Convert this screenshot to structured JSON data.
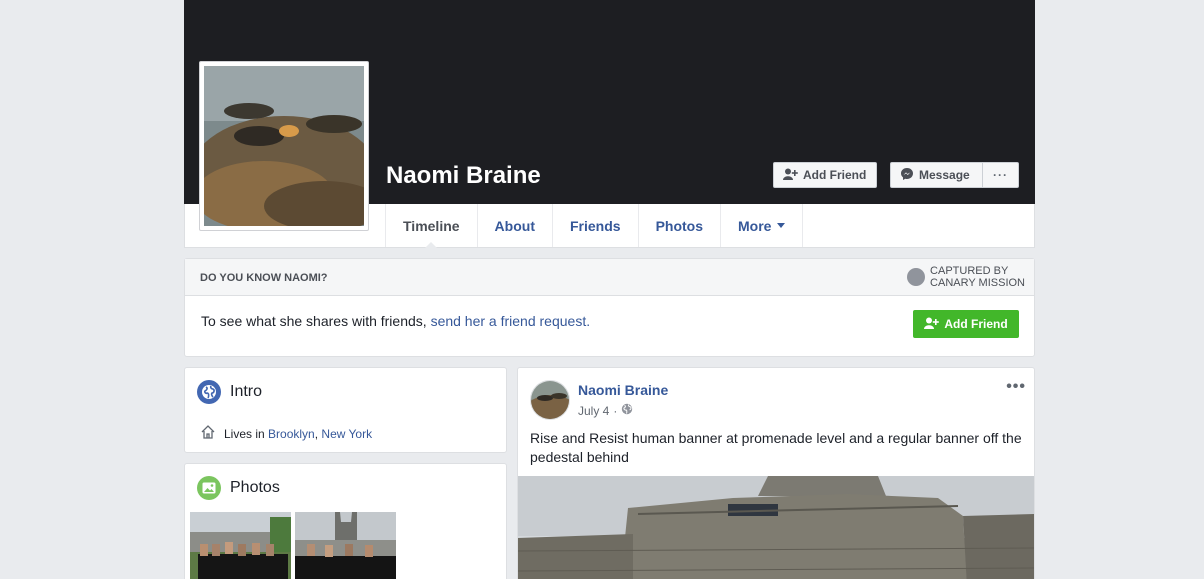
{
  "profile": {
    "name": "Naomi Braine"
  },
  "header_actions": {
    "add_friend": "Add Friend",
    "message": "Message",
    "more": "···"
  },
  "tabs": [
    {
      "label": "Timeline",
      "active": true
    },
    {
      "label": "About"
    },
    {
      "label": "Friends"
    },
    {
      "label": "Photos"
    },
    {
      "label": "More"
    }
  ],
  "know_box": {
    "title": "DO YOU KNOW NAOMI?",
    "watermark_line1": "CAPTURED BY",
    "watermark_line2": "CANARY MISSION",
    "body_text": "To see what she shares with friends,",
    "body_link": "send her a friend request.",
    "add_friend_button": "Add Friend"
  },
  "intro": {
    "title": "Intro",
    "lives_in_prefix": "Lives in",
    "city": "Brooklyn",
    "separator": ",",
    "state": "New York"
  },
  "photos": {
    "title": "Photos"
  },
  "post": {
    "author": "Naomi Braine",
    "date": "July 4",
    "date_separator": "·",
    "menu": "•••",
    "text": "Rise and Resist human banner at promenade level and a regular banner off the pedestal behind"
  },
  "colors": {
    "link": "#365899",
    "cover": "#1d1e22",
    "green_button": "#42b72a",
    "background": "#e9ebee"
  }
}
